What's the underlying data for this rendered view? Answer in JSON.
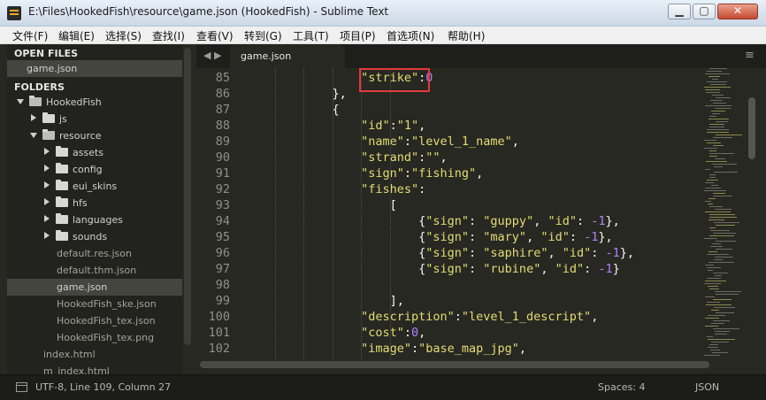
{
  "window": {
    "title": "E:\\Files\\HookedFish\\resource\\game.json (HookedFish) - Sublime Text",
    "minimize": "▁",
    "maximize": "▢",
    "close": "✕"
  },
  "menu": [
    "文件(F)",
    "编辑(E)",
    "选择(S)",
    "查找(I)",
    "查看(V)",
    "转到(G)",
    "工具(T)",
    "项目(P)",
    "首选项(N)",
    "帮助(H)"
  ],
  "sidebar": {
    "open_files_header": "OPEN FILES",
    "open_file": "game.json",
    "folders_header": "FOLDERS",
    "tree": [
      {
        "label": "HookedFish",
        "depth": 0,
        "type": "folder-open"
      },
      {
        "label": "js",
        "depth": 1,
        "type": "folder"
      },
      {
        "label": "resource",
        "depth": 1,
        "type": "folder-open"
      },
      {
        "label": "assets",
        "depth": 2,
        "type": "folder"
      },
      {
        "label": "config",
        "depth": 2,
        "type": "folder"
      },
      {
        "label": "eui_skins",
        "depth": 2,
        "type": "folder"
      },
      {
        "label": "hfs",
        "depth": 2,
        "type": "folder"
      },
      {
        "label": "languages",
        "depth": 2,
        "type": "folder"
      },
      {
        "label": "sounds",
        "depth": 2,
        "type": "folder"
      },
      {
        "label": "default.res.json",
        "depth": 2,
        "type": "file"
      },
      {
        "label": "default.thm.json",
        "depth": 2,
        "type": "file"
      },
      {
        "label": "game.json",
        "depth": 2,
        "type": "file",
        "selected": true
      },
      {
        "label": "HookedFish_ske.json",
        "depth": 2,
        "type": "file"
      },
      {
        "label": "HookedFish_tex.json",
        "depth": 2,
        "type": "file"
      },
      {
        "label": "HookedFish_tex.png",
        "depth": 2,
        "type": "file"
      },
      {
        "label": "index.html",
        "depth": 1,
        "type": "file"
      },
      {
        "label": "m_index.html",
        "depth": 1,
        "type": "file"
      }
    ]
  },
  "tabs": {
    "nav": "◀ ▶",
    "active": "game.json",
    "menu": "≡"
  },
  "editor": {
    "lines": [
      {
        "n": "85",
        "indent": 16,
        "tokens": [
          [
            "str",
            "\"strike\""
          ],
          [
            "p",
            ":"
          ],
          [
            "num",
            "0"
          ]
        ]
      },
      {
        "n": "86",
        "indent": 12,
        "tokens": [
          [
            "p",
            "},"
          ]
        ]
      },
      {
        "n": "87",
        "indent": 12,
        "tokens": [
          [
            "p",
            "{"
          ]
        ]
      },
      {
        "n": "88",
        "indent": 16,
        "tokens": [
          [
            "str",
            "\"id\""
          ],
          [
            "p",
            ":"
          ],
          [
            "str",
            "\"1\""
          ],
          [
            "p",
            ","
          ]
        ]
      },
      {
        "n": "89",
        "indent": 16,
        "tokens": [
          [
            "str",
            "\"name\""
          ],
          [
            "p",
            ":"
          ],
          [
            "str",
            "\"level_1_name\""
          ],
          [
            "p",
            ","
          ]
        ]
      },
      {
        "n": "90",
        "indent": 16,
        "tokens": [
          [
            "str",
            "\"strand\""
          ],
          [
            "p",
            ":"
          ],
          [
            "str",
            "\"\""
          ],
          [
            "p",
            ","
          ]
        ]
      },
      {
        "n": "91",
        "indent": 16,
        "tokens": [
          [
            "str",
            "\"sign\""
          ],
          [
            "p",
            ":"
          ],
          [
            "str",
            "\"fishing\""
          ],
          [
            "p",
            ","
          ]
        ]
      },
      {
        "n": "92",
        "indent": 16,
        "tokens": [
          [
            "str",
            "\"fishes\""
          ],
          [
            "p",
            ":"
          ]
        ]
      },
      {
        "n": "93",
        "indent": 20,
        "tokens": [
          [
            "p",
            "["
          ]
        ]
      },
      {
        "n": "94",
        "indent": 24,
        "tokens": [
          [
            "p",
            "{"
          ],
          [
            "str",
            "\"sign\""
          ],
          [
            "p",
            ": "
          ],
          [
            "str",
            "\"guppy\""
          ],
          [
            "p",
            ", "
          ],
          [
            "str",
            "\"id\""
          ],
          [
            "p",
            ": "
          ],
          [
            "num",
            "-1"
          ],
          [
            "p",
            "},"
          ]
        ]
      },
      {
        "n": "95",
        "indent": 24,
        "tokens": [
          [
            "p",
            "{"
          ],
          [
            "str",
            "\"sign\""
          ],
          [
            "p",
            ": "
          ],
          [
            "str",
            "\"mary\""
          ],
          [
            "p",
            ", "
          ],
          [
            "str",
            "\"id\""
          ],
          [
            "p",
            ": "
          ],
          [
            "num",
            "-1"
          ],
          [
            "p",
            "},"
          ]
        ]
      },
      {
        "n": "96",
        "indent": 24,
        "tokens": [
          [
            "p",
            "{"
          ],
          [
            "str",
            "\"sign\""
          ],
          [
            "p",
            ": "
          ],
          [
            "str",
            "\"saphire\""
          ],
          [
            "p",
            ", "
          ],
          [
            "str",
            "\"id\""
          ],
          [
            "p",
            ": "
          ],
          [
            "num",
            "-1"
          ],
          [
            "p",
            "},"
          ]
        ]
      },
      {
        "n": "97",
        "indent": 24,
        "tokens": [
          [
            "p",
            "{"
          ],
          [
            "str",
            "\"sign\""
          ],
          [
            "p",
            ": "
          ],
          [
            "str",
            "\"rubine\""
          ],
          [
            "p",
            ", "
          ],
          [
            "str",
            "\"id\""
          ],
          [
            "p",
            ": "
          ],
          [
            "num",
            "-1"
          ],
          [
            "p",
            "}"
          ]
        ]
      },
      {
        "n": "98",
        "indent": 0,
        "tokens": []
      },
      {
        "n": "99",
        "indent": 20,
        "tokens": [
          [
            "p",
            "],"
          ]
        ]
      },
      {
        "n": "100",
        "indent": 16,
        "tokens": [
          [
            "str",
            "\"description\""
          ],
          [
            "p",
            ":"
          ],
          [
            "str",
            "\"level_1_descript\""
          ],
          [
            "p",
            ","
          ]
        ]
      },
      {
        "n": "101",
        "indent": 16,
        "tokens": [
          [
            "str",
            "\"cost\""
          ],
          [
            "p",
            ":"
          ],
          [
            "num",
            "0"
          ],
          [
            "p",
            ","
          ]
        ]
      },
      {
        "n": "102",
        "indent": 16,
        "tokens": [
          [
            "str",
            "\"image\""
          ],
          [
            "p",
            ":"
          ],
          [
            "str",
            "\"base_map_jpg\""
          ],
          [
            "p",
            ","
          ]
        ]
      }
    ]
  },
  "status": {
    "left": "UTF-8, Line 109, Column 27",
    "spaces": "Spaces: 4",
    "syntax": "JSON"
  },
  "colors": {
    "string": "#e6db74",
    "number": "#ae81ff",
    "punctuation": "#f8f8f2",
    "background": "#272822",
    "highlight_box": "#e33a3a"
  }
}
